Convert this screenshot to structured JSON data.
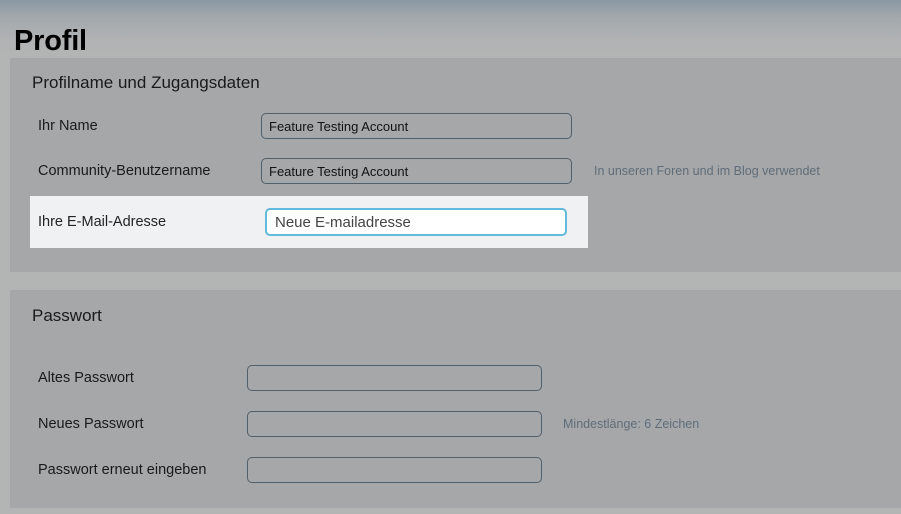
{
  "page": {
    "title": "Profil"
  },
  "sections": {
    "profile": {
      "heading": "Profilname und Zugangsdaten",
      "fields": {
        "name": {
          "label": "Ihr Name",
          "value": "Feature Testing Account"
        },
        "community_username": {
          "label": "Community-Benutzername",
          "value": "Feature Testing Account",
          "hint": "In unseren Foren und im Blog verwendet"
        },
        "email": {
          "label": "Ihre E-Mail-Adresse",
          "value": "",
          "placeholder": "Neue E-mailadresse",
          "focused": true
        }
      }
    },
    "password": {
      "heading": "Passwort",
      "fields": {
        "old_password": {
          "label": "Altes Passwort",
          "value": ""
        },
        "new_password": {
          "label": "Neues Passwort",
          "value": "",
          "hint": "Mindestlänge: 6 Zeichen"
        },
        "confirm_password": {
          "label": "Passwort erneut eingeben",
          "value": ""
        }
      }
    }
  },
  "colors": {
    "page_background": "#b3b4b4",
    "panel_background": "#a5a7a9",
    "header_gradient_top": "#8b98a3",
    "title_text": "#000000",
    "label_text": "#1a1a1a",
    "hint_text": "#5f6d7a",
    "field_border": "#52606b",
    "focus_border": "#62bbdd",
    "focus_row_background": "#f0f1f3"
  }
}
